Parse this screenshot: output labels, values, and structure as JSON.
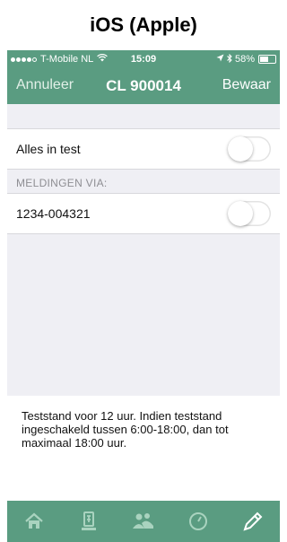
{
  "caption": "iOS (Apple)",
  "status_bar": {
    "carrier": "T-Mobile NL",
    "time": "15:09",
    "battery": "58%",
    "battery_level": 0.58
  },
  "nav": {
    "left": "Annuleer",
    "title": "CL 900014",
    "right": "Bewaar"
  },
  "settings": {
    "all_in_test": {
      "label": "Alles in test",
      "enabled": false
    },
    "section_header": "MELDINGEN VIA:",
    "phone": {
      "label": "1234-004321",
      "enabled": false
    }
  },
  "footer_text": "Teststand voor 12 uur. Indien teststand ingeschakeld tussen 6:00-18:00, dan tot maximaal 18:00 uur.",
  "tabbar": {
    "icons": [
      "home-icon",
      "document-icon",
      "people-icon",
      "clock-icon",
      "pen-icon"
    ]
  },
  "colors": {
    "brand": "#5a9c81",
    "background": "#efeff4"
  }
}
